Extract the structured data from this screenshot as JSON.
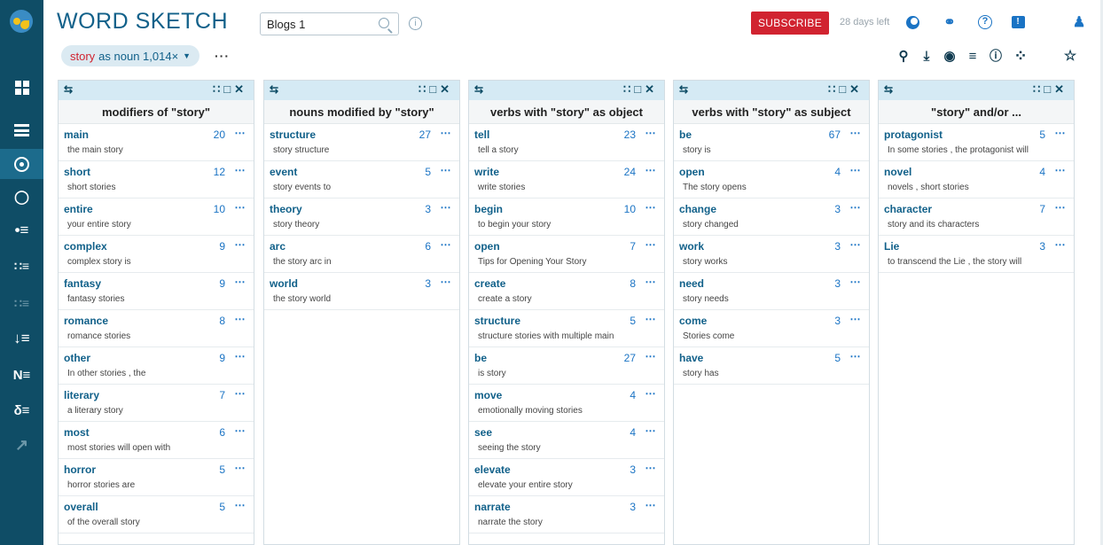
{
  "app": {
    "title": "WORD SKETCH"
  },
  "search": {
    "corpus_value": "Blogs 1"
  },
  "header": {
    "subscribe_label": "SUBSCRIBE",
    "days_left": "28 days left"
  },
  "query": {
    "keyword": "story",
    "rest": "as noun 1,014×"
  },
  "columns": [
    {
      "title": "modifiers of \"story\"",
      "rows": [
        {
          "word": "main",
          "count": "20",
          "example": "the main story"
        },
        {
          "word": "short",
          "count": "12",
          "example": "short stories"
        },
        {
          "word": "entire",
          "count": "10",
          "example": "your entire story"
        },
        {
          "word": "complex",
          "count": "9",
          "example": "complex story is"
        },
        {
          "word": "fantasy",
          "count": "9",
          "example": "fantasy stories"
        },
        {
          "word": "romance",
          "count": "8",
          "example": "romance stories"
        },
        {
          "word": "other",
          "count": "9",
          "example": "In other stories , the"
        },
        {
          "word": "literary",
          "count": "7",
          "example": "a literary story"
        },
        {
          "word": "most",
          "count": "6",
          "example": "most stories will open with"
        },
        {
          "word": "horror",
          "count": "5",
          "example": "horror stories are"
        },
        {
          "word": "overall",
          "count": "5",
          "example": "of the overall story"
        }
      ]
    },
    {
      "title": "nouns modified by \"story\"",
      "rows": [
        {
          "word": "structure",
          "count": "27",
          "example": "story structure"
        },
        {
          "word": "event",
          "count": "5",
          "example": "story events to"
        },
        {
          "word": "theory",
          "count": "3",
          "example": "story theory"
        },
        {
          "word": "arc",
          "count": "6",
          "example": "the story arc in"
        },
        {
          "word": "world",
          "count": "3",
          "example": "the story world"
        }
      ]
    },
    {
      "title": "verbs with \"story\" as object",
      "rows": [
        {
          "word": "tell",
          "count": "23",
          "example": "tell a story"
        },
        {
          "word": "write",
          "count": "24",
          "example": "write stories"
        },
        {
          "word": "begin",
          "count": "10",
          "example": "to begin your story"
        },
        {
          "word": "open",
          "count": "7",
          "example": "Tips for Opening Your Story"
        },
        {
          "word": "create",
          "count": "8",
          "example": "create a story"
        },
        {
          "word": "structure",
          "count": "5",
          "example": "structure stories with multiple main"
        },
        {
          "word": "be",
          "count": "27",
          "example": "is story"
        },
        {
          "word": "move",
          "count": "4",
          "example": "emotionally moving stories"
        },
        {
          "word": "see",
          "count": "4",
          "example": "seeing the story"
        },
        {
          "word": "elevate",
          "count": "3",
          "example": "elevate your entire story"
        },
        {
          "word": "narrate",
          "count": "3",
          "example": "narrate the story"
        }
      ]
    },
    {
      "title": "verbs with \"story\" as subject",
      "rows": [
        {
          "word": "be",
          "count": "67",
          "example": "story is"
        },
        {
          "word": "open",
          "count": "4",
          "example": "The story opens"
        },
        {
          "word": "change",
          "count": "3",
          "example": "story changed"
        },
        {
          "word": "work",
          "count": "3",
          "example": "story works"
        },
        {
          "word": "need",
          "count": "3",
          "example": "story needs"
        },
        {
          "word": "come",
          "count": "3",
          "example": "Stories come"
        },
        {
          "word": "have",
          "count": "5",
          "example": "story has"
        }
      ]
    },
    {
      "title": "\"story\" and/or ...",
      "rows": [
        {
          "word": "protagonist",
          "count": "5",
          "example": "In some stories , the protagonist will"
        },
        {
          "word": "novel",
          "count": "4",
          "example": "novels , short stories"
        },
        {
          "word": "character",
          "count": "7",
          "example": "story and its characters"
        },
        {
          "word": "Lie",
          "count": "3",
          "example": "to transcend the Lie , the story will"
        }
      ]
    }
  ],
  "icons": {
    "sidebar": [
      "dashboard-icon",
      "concordance-icon",
      "word-sketch-icon",
      "thesaurus-icon",
      "wordlist-icon",
      "word-sketch-difference-icon",
      "keywords-icon",
      "ngrams-icon",
      "named-entities-icon",
      "text-type-analysis-icon",
      "trends-icon"
    ],
    "header": [
      "dark-mode-icon",
      "link-icon",
      "help-icon",
      "feedback-icon",
      "user-icon"
    ],
    "toolbar": [
      "zoom-icon",
      "download-icon",
      "view-options-icon",
      "filter-icon",
      "info-icon",
      "visualize-icon",
      "favorite-icon"
    ]
  },
  "colors": {
    "sidebar_bg": "#0f4d66",
    "accent": "#12618a",
    "subscribe": "#d12330",
    "column_header": "#d5eaf4"
  }
}
